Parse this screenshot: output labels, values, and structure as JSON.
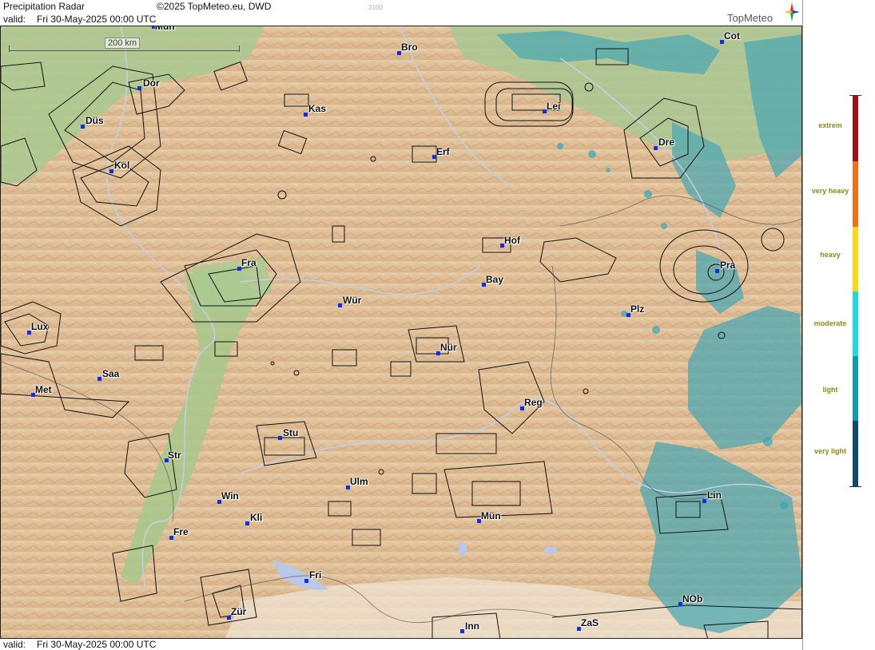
{
  "header": {
    "title": "Precipitation Radar",
    "copyright": "©2025 TopMeteo.eu, DWD",
    "code": "3100",
    "valid_label": "valid:",
    "valid_time": "Fri  30-May-2025 00:00 UTC",
    "brand": "TopMeteo"
  },
  "footer": {
    "valid_label": "valid:",
    "valid_time": "Fri  30-May-2025 00:00 UTC"
  },
  "scale_bar": {
    "label": "200 km"
  },
  "legend": {
    "labels": [
      "extrem",
      "very heavy",
      "heavy",
      "moderate",
      "light",
      "very light"
    ],
    "colors": [
      "#a01010",
      "#f07018",
      "#f8d818",
      "#20d8e0",
      "#109ab0",
      "#104a6a"
    ]
  },
  "cities": [
    {
      "name": "Mün"
    },
    {
      "name": "Bro"
    },
    {
      "name": "Cot"
    },
    {
      "name": "Dor"
    },
    {
      "name": "Kas"
    },
    {
      "name": "Lei"
    },
    {
      "name": "Düs"
    },
    {
      "name": "Erf"
    },
    {
      "name": "Dre"
    },
    {
      "name": "Köl"
    },
    {
      "name": "Hof"
    },
    {
      "name": "Fra"
    },
    {
      "name": "Pra"
    },
    {
      "name": "Bay"
    },
    {
      "name": "Wür"
    },
    {
      "name": "Plz"
    },
    {
      "name": "Lux"
    },
    {
      "name": "Nür"
    },
    {
      "name": "Saa"
    },
    {
      "name": "Met"
    },
    {
      "name": "Reg"
    },
    {
      "name": "Stu"
    },
    {
      "name": "Str"
    },
    {
      "name": "Ulm"
    },
    {
      "name": "Win"
    },
    {
      "name": "Lin"
    },
    {
      "name": "Kli"
    },
    {
      "name": "Mün"
    },
    {
      "name": "Fre"
    },
    {
      "name": "Fri"
    },
    {
      "name": "NÖb"
    },
    {
      "name": "Zür"
    },
    {
      "name": "ZaS"
    },
    {
      "name": "Inn"
    }
  ]
}
